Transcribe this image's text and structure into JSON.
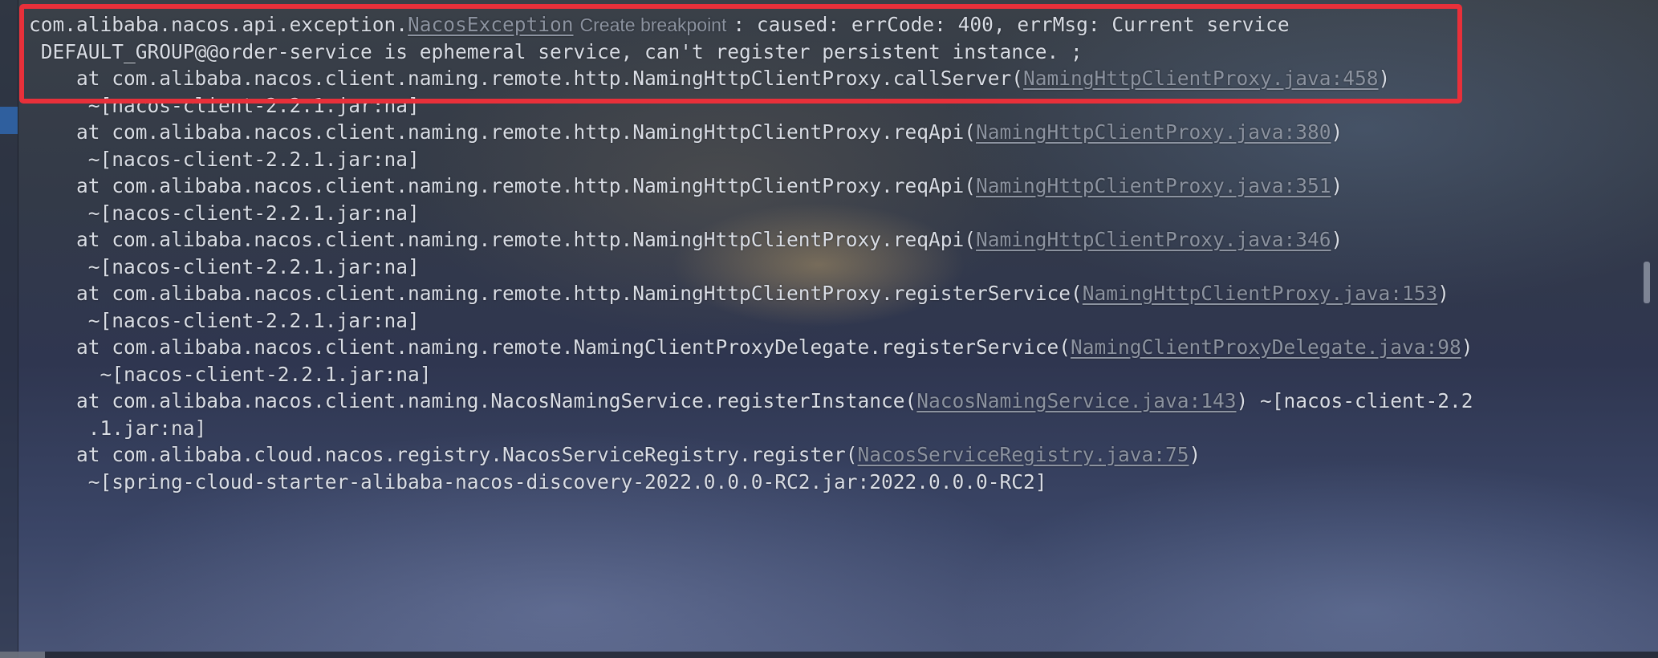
{
  "console": {
    "lines": [
      {
        "parts": [
          {
            "text": "com.alibaba.nacos.api.exception.",
            "style": "text"
          },
          {
            "text": "NacosException",
            "style": "link"
          },
          {
            "text": "Create breakpoint",
            "style": "hint"
          },
          {
            "text": ": caused: errCode: 400, errMsg: Current service",
            "style": "text"
          }
        ]
      },
      {
        "parts": [
          {
            "text": " DEFAULT_GROUP@@order-service is ephemeral service, can't register persistent instance. ;",
            "style": "text"
          }
        ]
      },
      {
        "parts": [
          {
            "text": "    at com.alibaba.nacos.client.naming.remote.http.NamingHttpClientProxy.callServer(",
            "style": "text"
          },
          {
            "text": "NamingHttpClientProxy.java:458",
            "style": "link"
          },
          {
            "text": ")",
            "style": "text"
          }
        ]
      },
      {
        "parts": [
          {
            "text": "     ~[nacos-client-2.2.1.jar:na]",
            "style": "text"
          }
        ]
      },
      {
        "parts": [
          {
            "text": "    at com.alibaba.nacos.client.naming.remote.http.NamingHttpClientProxy.reqApi(",
            "style": "text"
          },
          {
            "text": "NamingHttpClientProxy.java:380",
            "style": "link"
          },
          {
            "text": ")",
            "style": "text"
          }
        ]
      },
      {
        "parts": [
          {
            "text": "     ~[nacos-client-2.2.1.jar:na]",
            "style": "text"
          }
        ]
      },
      {
        "parts": [
          {
            "text": "    at com.alibaba.nacos.client.naming.remote.http.NamingHttpClientProxy.reqApi(",
            "style": "text"
          },
          {
            "text": "NamingHttpClientProxy.java:351",
            "style": "link"
          },
          {
            "text": ")",
            "style": "text"
          }
        ]
      },
      {
        "parts": [
          {
            "text": "     ~[nacos-client-2.2.1.jar:na]",
            "style": "text"
          }
        ]
      },
      {
        "parts": [
          {
            "text": "    at com.alibaba.nacos.client.naming.remote.http.NamingHttpClientProxy.reqApi(",
            "style": "text"
          },
          {
            "text": "NamingHttpClientProxy.java:346",
            "style": "link"
          },
          {
            "text": ")",
            "style": "text"
          }
        ]
      },
      {
        "parts": [
          {
            "text": "     ~[nacos-client-2.2.1.jar:na]",
            "style": "text"
          }
        ]
      },
      {
        "parts": [
          {
            "text": "    at com.alibaba.nacos.client.naming.remote.http.NamingHttpClientProxy.registerService(",
            "style": "text"
          },
          {
            "text": "NamingHttpClientProxy.java:153",
            "style": "link"
          },
          {
            "text": ")",
            "style": "text"
          }
        ]
      },
      {
        "parts": [
          {
            "text": "     ~[nacos-client-2.2.1.jar:na]",
            "style": "text"
          }
        ]
      },
      {
        "parts": [
          {
            "text": "    at com.alibaba.nacos.client.naming.remote.NamingClientProxyDelegate.registerService(",
            "style": "text"
          },
          {
            "text": "NamingClientProxyDelegate.java:98",
            "style": "link"
          },
          {
            "text": ")",
            "style": "text"
          }
        ]
      },
      {
        "parts": [
          {
            "text": "      ~[nacos-client-2.2.1.jar:na]",
            "style": "text"
          }
        ]
      },
      {
        "parts": [
          {
            "text": "    at com.alibaba.nacos.client.naming.NacosNamingService.registerInstance(",
            "style": "text"
          },
          {
            "text": "NacosNamingService.java:143",
            "style": "link"
          },
          {
            "text": ") ~[nacos-client-2.2",
            "style": "text"
          }
        ]
      },
      {
        "parts": [
          {
            "text": "     .1.jar:na]",
            "style": "text"
          }
        ]
      },
      {
        "parts": [
          {
            "text": "    at com.alibaba.cloud.nacos.registry.NacosServiceRegistry.register(",
            "style": "text"
          },
          {
            "text": "NacosServiceRegistry.java:75",
            "style": "link"
          },
          {
            "text": ")",
            "style": "text"
          }
        ]
      },
      {
        "parts": [
          {
            "text": "     ~[spring-cloud-starter-alibaba-nacos-discovery-2022.0.0.0-RC2.jar:2022.0.0.0-RC2]",
            "style": "text"
          }
        ]
      }
    ]
  },
  "highlight": {
    "color": "#e8303a"
  }
}
